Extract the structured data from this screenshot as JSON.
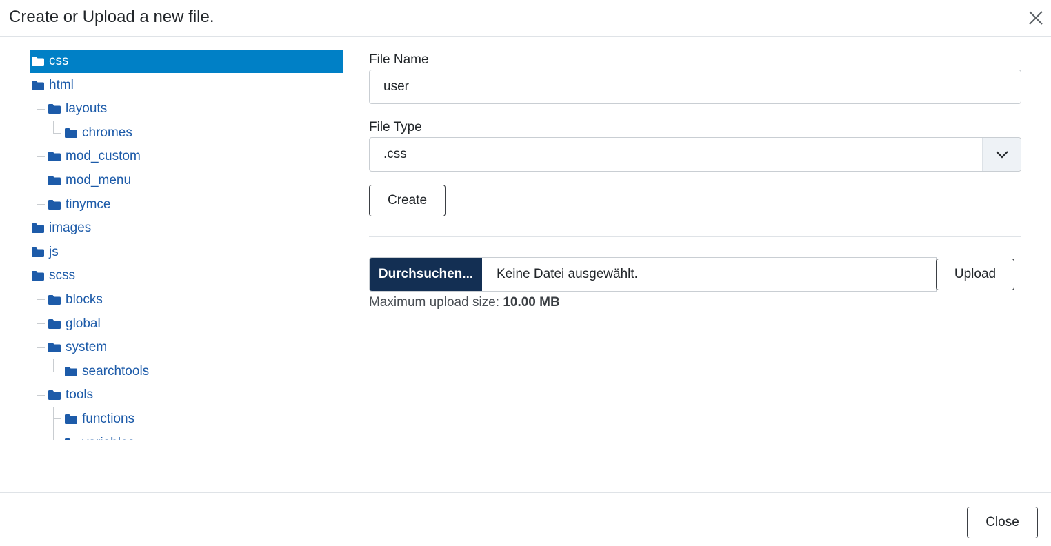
{
  "header": {
    "title": "Create or Upload a new file.",
    "close_icon": "close-icon"
  },
  "tree": {
    "items": [
      {
        "label": "css",
        "depth": 0,
        "selected": true
      },
      {
        "label": "html",
        "depth": 0,
        "selected": false
      },
      {
        "label": "layouts",
        "depth": 1,
        "selected": false
      },
      {
        "label": "chromes",
        "depth": 2,
        "selected": false
      },
      {
        "label": "mod_custom",
        "depth": 1,
        "selected": false
      },
      {
        "label": "mod_menu",
        "depth": 1,
        "selected": false
      },
      {
        "label": "tinymce",
        "depth": 1,
        "selected": false
      },
      {
        "label": "images",
        "depth": 0,
        "selected": false
      },
      {
        "label": "js",
        "depth": 0,
        "selected": false
      },
      {
        "label": "scss",
        "depth": 0,
        "selected": false
      },
      {
        "label": "blocks",
        "depth": 1,
        "selected": false
      },
      {
        "label": "global",
        "depth": 1,
        "selected": false
      },
      {
        "label": "system",
        "depth": 1,
        "selected": false
      },
      {
        "label": "searchtools",
        "depth": 2,
        "selected": false
      },
      {
        "label": "tools",
        "depth": 1,
        "selected": false
      },
      {
        "label": "functions",
        "depth": 2,
        "selected": false
      },
      {
        "label": "variables",
        "depth": 2,
        "selected": false
      }
    ]
  },
  "form": {
    "file_name_label": "File Name",
    "file_name_value": "user",
    "file_type_label": "File Type",
    "file_type_value": ".css",
    "create_label": "Create",
    "browse_label": "Durchsuchen...",
    "file_status": "Keine Datei ausgewählt.",
    "upload_label": "Upload",
    "max_size_label": "Maximum upload size:",
    "max_size_value": "10.00 MB"
  },
  "footer": {
    "close_label": "Close"
  },
  "colors": {
    "selected_bg": "#0080c6",
    "link": "#1d5ba9",
    "browse_bg": "#132f53"
  }
}
